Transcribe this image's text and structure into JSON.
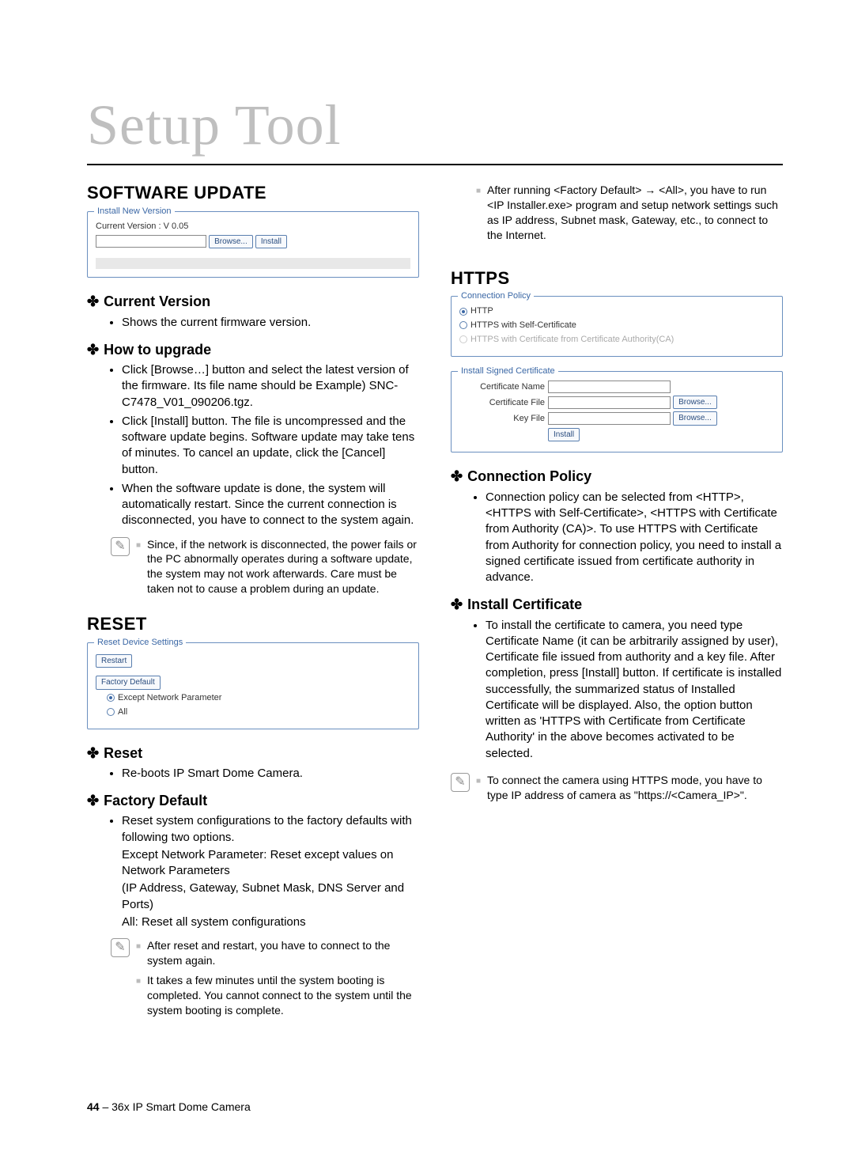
{
  "page_title": "Setup Tool",
  "footer": {
    "page_number": "44",
    "doc_label": " – 36x IP Smart Dome Camera"
  },
  "software_update": {
    "heading": "SOFTWARE UPDATE",
    "panel": {
      "legend": "Install New Version",
      "current_label": "Current Version : V 0.05",
      "browse": "Browse...",
      "install": "Install"
    },
    "current_version": {
      "title": "Current Version",
      "text": "Shows the current firmware version."
    },
    "how_to_upgrade": {
      "title": "How to upgrade",
      "items": [
        "Click [Browse…] button and select the latest version of the firmware. Its file name should be Example) SNC-C7478_V01_090206.tgz.",
        "Click [Install] button. The file is uncompressed and the software update begins. Software update may take tens of minutes. To cancel an update, click the [Cancel] button.",
        "When the software update is done, the system will automatically restart. Since the current connection is disconnected, you have to connect to the system again."
      ],
      "note": "Since, if the network is disconnected, the power fails or the PC abnormally operates during a software update, the system may not work afterwards. Care must be taken not to cause a problem during an update."
    }
  },
  "reset": {
    "heading": "RESET",
    "panel": {
      "legend": "Reset Device Settings",
      "restart": "Restart",
      "factory": "Factory Default",
      "option1": "Except Network Parameter",
      "option2": "All"
    },
    "reset_sub": {
      "title": "Reset",
      "text": "Re-boots IP Smart Dome Camera."
    },
    "factory_default": {
      "title": "Factory Default",
      "items": [
        "Reset system configurations to the factory defaults with following two options."
      ],
      "cont1": "Except Network Parameter:  Reset except values on Network Parameters",
      "cont2": "(IP Address, Gateway, Subnet Mask, DNS Server and Ports)",
      "cont3": "All:  Reset all system configurations",
      "notes": [
        "After reset and restart, you have to connect to the system again.",
        "It takes a few minutes until the system booting is completed. You cannot connect to the system until the system booting is complete."
      ]
    }
  },
  "right_top_note": "After running <Factory Default> → <All>, you have to run <IP Installer.exe> program and setup network settings such as IP address, Subnet mask, Gateway, etc., to connect to the Internet.",
  "https": {
    "heading": "HTTPS",
    "panel1": {
      "legend": "Connection Policy",
      "opt1": "HTTP",
      "opt2": "HTTPS with Self-Certificate",
      "opt3": "HTTPS with Certificate from Certificate Authority(CA)"
    },
    "panel2": {
      "legend": "Install Signed Certificate",
      "name_label": "Certificate Name",
      "file_label": "Certificate File",
      "key_label": "Key File",
      "browse": "Browse...",
      "install": "Install"
    },
    "connection_policy": {
      "title": "Connection Policy",
      "text": "Connection policy can be selected from <HTTP>, <HTTPS with Self-Certificate>, <HTTPS with Certificate from Authority (CA)>. To use HTTPS with Certificate from Authority for connection policy, you need to install a signed certificate issued from certificate authority in advance."
    },
    "install_cert": {
      "title": "Install Certificate",
      "text": "To install the certificate to camera, you need type Certificate Name (it can be arbitrarily assigned by user), Certificate file issued from authority and a key file. After completion, press [Install] button. If certificate is installed successfully, the summarized status of Installed Certificate will be displayed. Also, the option button written as 'HTTPS with Certificate from Certificate Authority' in the above becomes activated to be selected."
    },
    "note": "To connect the camera using HTTPS mode, you have to type IP address of camera as \"https://<Camera_IP>\"."
  }
}
